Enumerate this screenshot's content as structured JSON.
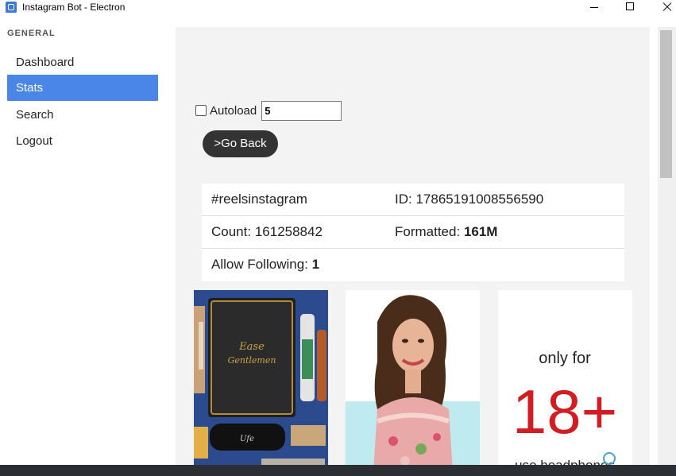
{
  "window": {
    "title": "Instagram Bot - Electron"
  },
  "sidebar": {
    "heading": "GENERAL",
    "items": [
      {
        "label": "Dashboard",
        "active": false
      },
      {
        "label": "Stats",
        "active": true
      },
      {
        "label": "Search",
        "active": false
      },
      {
        "label": "Logout",
        "active": false
      }
    ]
  },
  "controls": {
    "autoload_label": "Autoload",
    "autoload_checked": false,
    "autoload_value": "5",
    "go_back_label": ">Go Back"
  },
  "stats": {
    "hashtag": "#reelsinstagram",
    "id_label": "ID:",
    "id_value": "17865191008556590",
    "count_label": "Count:",
    "count_value": "161258842",
    "formatted_label": "Formatted:",
    "formatted_value": "161M",
    "allow_following_label": "Allow Following:",
    "allow_following_value": "1"
  },
  "thumbnails": [
    {
      "name": "product-box-image"
    },
    {
      "name": "woman-portrait-image"
    },
    {
      "name": "only-for-18-plus-image",
      "text_line1": "only for",
      "text_line2": "18+",
      "text_line3": "use headphones"
    }
  ],
  "colors": {
    "accent": "#4a86e8",
    "button_dark": "#333333",
    "main_bg": "#f3f3f3"
  }
}
